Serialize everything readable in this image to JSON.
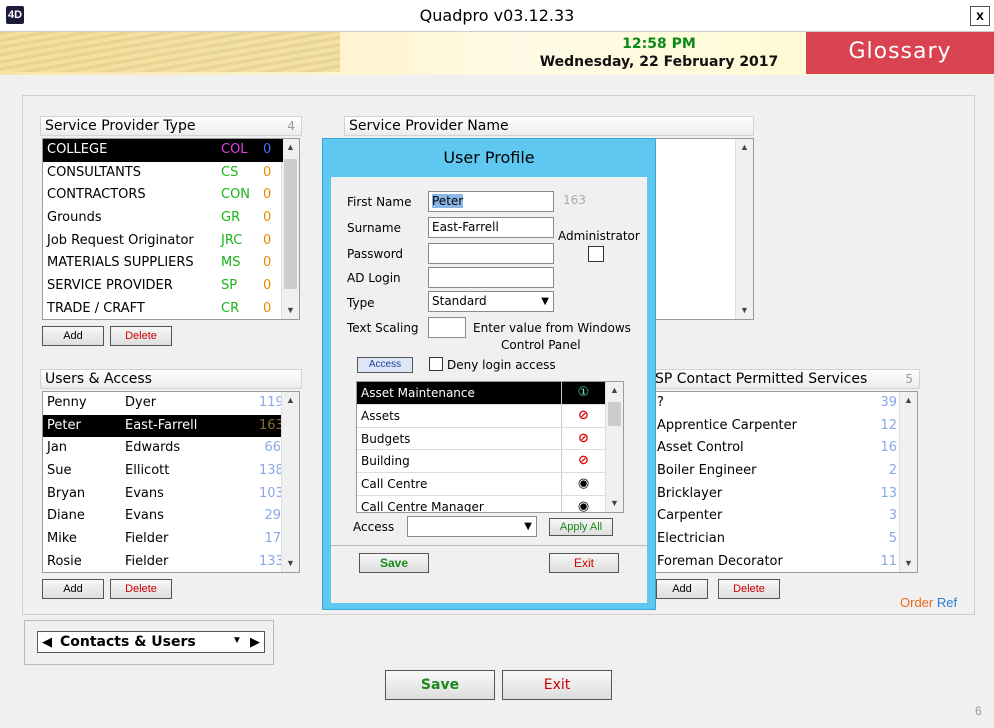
{
  "window": {
    "title": "Quadpro v03.12.33",
    "close_label": "x",
    "app_icon": "4D"
  },
  "header": {
    "time": "12:58 PM",
    "date": "Wednesday, 22 February 2017",
    "glossary": "Glossary"
  },
  "sp_type": {
    "title": "Service Provider Type",
    "count": "4",
    "rows": [
      {
        "name": "COLLEGE",
        "code": "COL",
        "num": "0",
        "selected": true
      },
      {
        "name": "CONSULTANTS",
        "code": "CS",
        "num": "0"
      },
      {
        "name": "CONTRACTORS",
        "code": "CON",
        "num": "0"
      },
      {
        "name": "Grounds",
        "code": "GR",
        "num": "0"
      },
      {
        "name": "Job Request Originator",
        "code": "JRC",
        "num": "0"
      },
      {
        "name": "MATERIALS SUPPLIERS",
        "code": "MS",
        "num": "0"
      },
      {
        "name": "SERVICE PROVIDER",
        "code": "SP",
        "num": "0"
      },
      {
        "name": "TRADE / CRAFT",
        "code": "CR",
        "num": "0"
      }
    ],
    "add": "Add",
    "delete": "Delete"
  },
  "sp_name": {
    "title": "Service Provider Name"
  },
  "users": {
    "title": "Users & Access",
    "rows": [
      {
        "first": "Penny",
        "last": "Dyer",
        "id": "119"
      },
      {
        "first": "Peter",
        "last": "East-Farrell",
        "id": "163",
        "selected": true
      },
      {
        "first": "Jan",
        "last": "Edwards",
        "id": "66"
      },
      {
        "first": "Sue",
        "last": "Ellicott",
        "id": "138"
      },
      {
        "first": "Bryan",
        "last": "Evans",
        "id": "103"
      },
      {
        "first": "Diane",
        "last": "Evans",
        "id": "29"
      },
      {
        "first": "Mike",
        "last": "Fielder",
        "id": "17"
      },
      {
        "first": "Rosie",
        "last": "Fielder",
        "id": "133"
      }
    ],
    "add": "Add",
    "delete": "Delete"
  },
  "sp_contact": {
    "title": "SP Contact Permitted Services",
    "count": "5",
    "rows": [
      {
        "name": "?",
        "num": "39"
      },
      {
        "name": "Apprentice Carpenter",
        "num": "12"
      },
      {
        "name": "Asset Control",
        "num": "16"
      },
      {
        "name": "Boiler Engineer",
        "num": "2"
      },
      {
        "name": "Bricklayer",
        "num": "13"
      },
      {
        "name": "Carpenter",
        "num": "3"
      },
      {
        "name": "Electrician",
        "num": "5"
      },
      {
        "name": "Foreman Decorator",
        "num": "11"
      }
    ],
    "add": "Add",
    "delete": "Delete",
    "order": "Order",
    "ref": "Ref"
  },
  "dialog": {
    "title": "User Profile",
    "first_name_label": "First Name",
    "first_name": "Peter",
    "user_id": "163",
    "surname_label": "Surname",
    "surname": "East-Farrell",
    "administrator_label": "Administrator",
    "password_label": "Password",
    "password": "",
    "ad_login_label": "AD Login",
    "ad_login": "",
    "type_label": "Type",
    "type_value": "Standard",
    "text_scaling_label": "Text Scaling",
    "text_scaling": "",
    "text_scaling_hint1": "Enter value from Windows",
    "text_scaling_hint2": "Control Panel",
    "access_btn": "Access",
    "deny_label": "Deny login access",
    "permissions": [
      {
        "name": "Asset Maintenance",
        "icon": "①",
        "kind": "full",
        "selected": true
      },
      {
        "name": "Assets",
        "icon": "⊘",
        "kind": "deny"
      },
      {
        "name": "Budgets",
        "icon": "⊘",
        "kind": "deny"
      },
      {
        "name": "Building",
        "icon": "⊘",
        "kind": "deny"
      },
      {
        "name": "Call Centre",
        "icon": "◉",
        "kind": "view"
      },
      {
        "name": "Call Centre Manager",
        "icon": "◉",
        "kind": "view"
      }
    ],
    "access_label": "Access",
    "access_value": "",
    "apply_all": "Apply All",
    "save": "Save",
    "exit": "Exit"
  },
  "footer": {
    "tab_label": "Contacts & Users",
    "save": "Save",
    "exit": "Exit",
    "page_num": "6"
  }
}
